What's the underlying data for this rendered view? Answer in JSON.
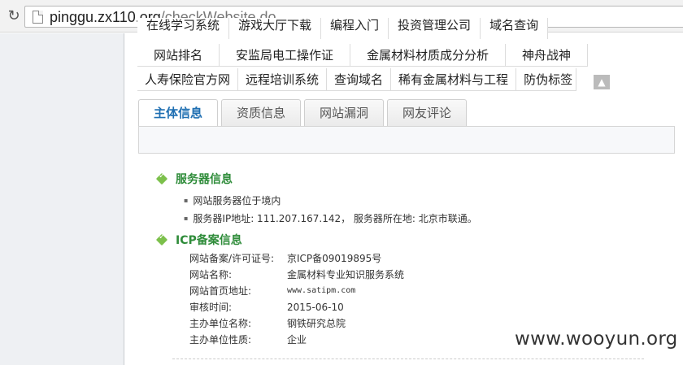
{
  "browser": {
    "url_host": "pinggu.zx110.org",
    "url_path": "/checkWebsite.do"
  },
  "keywords": {
    "row0": [
      "在线学习系统",
      "游戏大厅下载",
      "编程入门",
      "投资管理公司",
      "域名查询"
    ],
    "row1": [
      "网站排名",
      "安监局电工操作证",
      "金属材料材质成分分析",
      "神舟战神"
    ],
    "row2": [
      "人寿保险官方网",
      "远程培训系统",
      "查询域名",
      "稀有金属材料与工程",
      "防伪标签"
    ]
  },
  "tabs": [
    {
      "label": "主体信息"
    },
    {
      "label": "资质信息"
    },
    {
      "label": "网站漏洞"
    },
    {
      "label": "网友评论"
    }
  ],
  "server_section": {
    "title": "服务器信息",
    "items": [
      "网站服务器位于境内",
      "服务器IP地址: 111.207.167.142，  服务器所在地: 北京市联通。"
    ]
  },
  "icp_section": {
    "title": "ICP备案信息",
    "rows": [
      {
        "key": "网站备案/许可证号:",
        "value": "京ICP备09019895号"
      },
      {
        "key": "网站名称:",
        "value": "金属材料专业知识服务系统"
      },
      {
        "key": "网站首页地址:",
        "value": "www.satipm.com"
      },
      {
        "key": "审核时间:",
        "value": "2015-06-10"
      },
      {
        "key": "主办单位名称:",
        "value": "钢铁研究总院"
      },
      {
        "key": "主办单位性质:",
        "value": "企业"
      }
    ]
  },
  "watermark": "www.wooyun.org"
}
